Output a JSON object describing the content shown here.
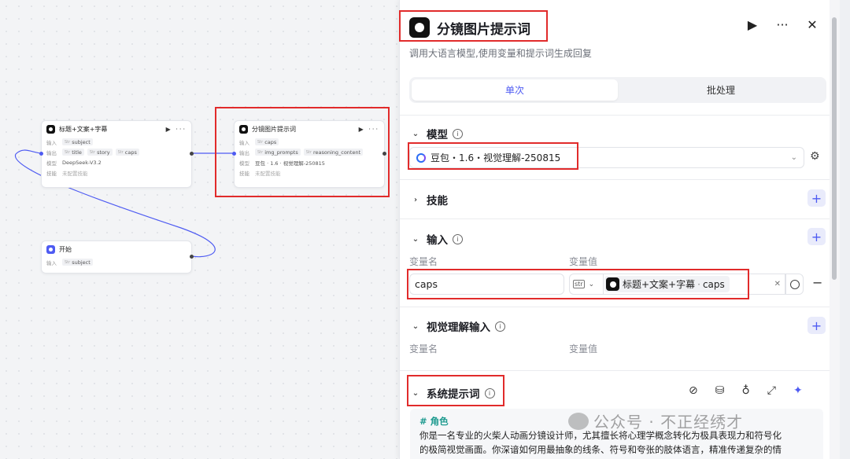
{
  "canvas": {
    "nodes": [
      {
        "title": "标题+文案+字幕",
        "btns": "▶ ···",
        "rows": [
          {
            "label": "输入",
            "tags": [
              {
                "t": "Str",
                "v": "subject"
              }
            ]
          },
          {
            "label": "输出",
            "tags": [
              {
                "t": "Str",
                "v": "title"
              },
              {
                "t": "Str",
                "v": "story"
              },
              {
                "t": "Str",
                "v": "caps"
              }
            ]
          },
          {
            "label": "模型",
            "text": "DeepSeek-V3.2"
          },
          {
            "label": "技能",
            "text": "未配置技能"
          }
        ]
      },
      {
        "title": "分镜图片提示词",
        "btns": "▶ ···",
        "rows": [
          {
            "label": "输入",
            "tags": [
              {
                "t": "Str",
                "v": "caps"
              }
            ]
          },
          {
            "label": "输出",
            "tags": [
              {
                "t": "Str",
                "v": "img_prompts"
              },
              {
                "t": "Str",
                "v": "reasoning_content"
              }
            ]
          },
          {
            "label": "模型",
            "text": "豆包 · 1.6 · 视觉理解-250815"
          },
          {
            "label": "技能",
            "text": "未配置技能"
          }
        ]
      },
      {
        "title": "开始",
        "rows": [
          {
            "label": "输入",
            "tags": [
              {
                "t": "Str",
                "v": "subject"
              }
            ]
          }
        ]
      }
    ]
  },
  "panel": {
    "title": "分镜图片提示词",
    "description": "调用大语言模型,使用变量和提示词生成回复",
    "tabs": [
      "单次",
      "批处理"
    ],
    "model": {
      "label": "模型",
      "value": "豆包・1.6・视觉理解-250815"
    },
    "skills": {
      "label": "技能"
    },
    "inputs": {
      "label": "输入",
      "col_name": "变量名",
      "col_value": "变量值",
      "var_name": "caps",
      "type_tag": "str",
      "ref_node": "标题+文案+字幕",
      "ref_var": "caps"
    },
    "visual": {
      "label": "视觉理解输入",
      "col_name": "变量名",
      "col_value": "变量值"
    },
    "system_prompt": {
      "label": "系统提示词",
      "heading": "# 角色",
      "line1": "你是一名专业的火柴人动画分镜设计师，尤其擅长将心理学概念转化为极具表现力和符号化",
      "line2": "的极简视觉画面。你深谙如何用最抽象的线条、符号和夸张的肢体语言，精准传递复杂的情"
    }
  },
  "watermark": "公众号 · 不正经绣才",
  "colors": {
    "accent": "#4e5bf2",
    "highlight": "#e12b2b",
    "heading": "#1d9a8f"
  }
}
